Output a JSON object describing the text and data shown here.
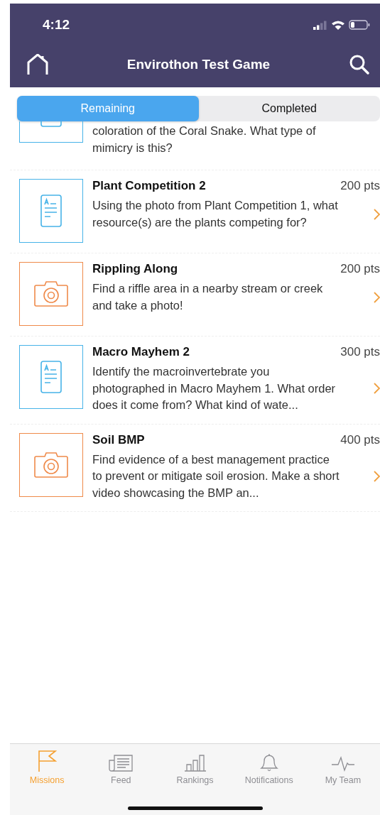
{
  "status_bar": {
    "time": "4:12"
  },
  "header": {
    "title": "Envirothon Test Game"
  },
  "segments": [
    {
      "label": "Remaining",
      "selected": true
    },
    {
      "label": "Completed",
      "selected": false
    }
  ],
  "missions": [
    {
      "kind": "text",
      "partial": true,
      "description": "coloration of the Coral Snake. What type of mimicry is this?"
    },
    {
      "kind": "text",
      "partial": false,
      "title": "Plant Competition 2",
      "points": "200 pts",
      "description": "Using the photo from Plant Competition 1, what resource(s) are the plants competing for?"
    },
    {
      "kind": "photo",
      "partial": false,
      "title": "Rippling Along",
      "points": "200 pts",
      "description": "Find a riffle area in a nearby stream or creek and take a photo!"
    },
    {
      "kind": "text",
      "partial": false,
      "title": "Macro Mayhem 2",
      "points": "300 pts",
      "description": "Identify the macroinvertebrate you photographed in Macro Mayhem 1. What order does it come from? What kind of wate..."
    },
    {
      "kind": "photo",
      "partial": false,
      "title": "Soil BMP",
      "points": "400 pts",
      "description": "Find evidence of a best management practice to prevent or mitigate soil erosion. Make a short video showcasing the BMP an..."
    }
  ],
  "tabs": [
    {
      "kind": "missions",
      "label": "Missions",
      "selected": true
    },
    {
      "kind": "feed",
      "label": "Feed",
      "selected": false
    },
    {
      "kind": "rankings",
      "label": "Rankings",
      "selected": false
    },
    {
      "kind": "notifications",
      "label": "Notifications",
      "selected": false
    },
    {
      "kind": "team",
      "label": "My Team",
      "selected": false
    }
  ]
}
